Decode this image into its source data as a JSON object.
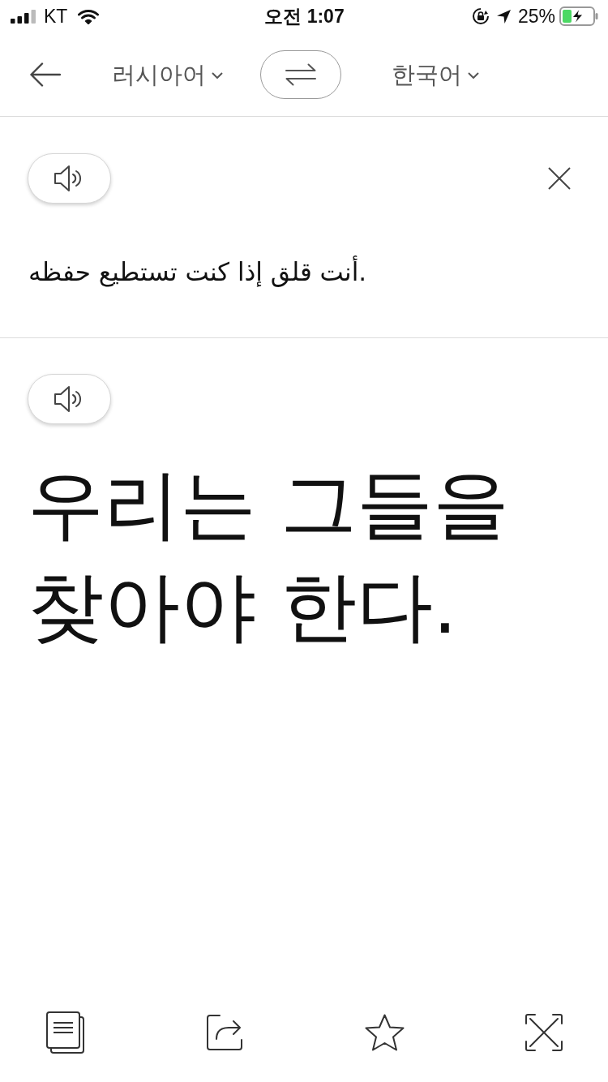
{
  "status_bar": {
    "carrier": "KT",
    "time": "오전 1:07",
    "battery_percent": "25%",
    "charging": true
  },
  "header": {
    "source_language": "러시아어",
    "target_language": "한국어"
  },
  "source": {
    "text": "أنت قلق إذا كنت تستطيع حفظه."
  },
  "translation": {
    "text": "우리는 그들을 찾아야 한다."
  }
}
